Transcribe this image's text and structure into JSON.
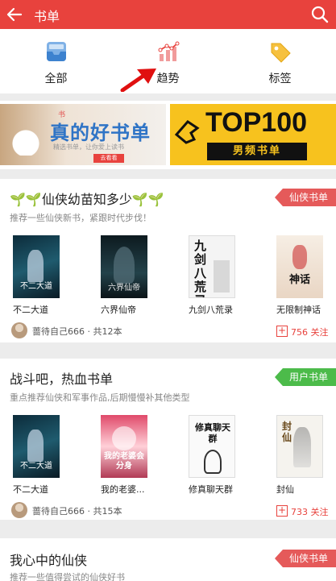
{
  "header": {
    "title": "书单"
  },
  "categories": [
    {
      "label": "全部",
      "icon": "inbox-icon"
    },
    {
      "label": "趋势",
      "icon": "trend-chart-icon"
    },
    {
      "label": "标签",
      "icon": "tag-icon"
    }
  ],
  "banners": [
    {
      "headline": "真的好书单",
      "top_text": "书",
      "sub_text": "精选书单，让你爱上读书",
      "button": "去看看"
    },
    {
      "headline": "TOP100",
      "sub_text": "男频书单"
    }
  ],
  "sections": [
    {
      "title": "仙侠幼苗知多少",
      "description": "推荐一些仙侠新书，紧跟时代步伐！",
      "tag": "仙侠书单",
      "books": [
        {
          "name": "不二大道",
          "cover_text": "不二大道"
        },
        {
          "name": "六界仙帝",
          "cover_text": "六界仙帝"
        },
        {
          "name": "九剑八荒录",
          "cover_text": "九剑八荒录"
        },
        {
          "name": "无限制神话",
          "cover_text": "神话"
        }
      ],
      "owner": "蔷待自己666 · 共12本",
      "follow": "756 关注"
    },
    {
      "title": "战斗吧，热血书单",
      "description": "重点推荐仙侠和军事作品,后期慢慢补其他类型",
      "tag": "用户书单",
      "books": [
        {
          "name": "不二大道",
          "cover_text": "不二大道"
        },
        {
          "name": "我的老婆...",
          "cover_text": "我的老婆会分身"
        },
        {
          "name": "修真聊天群",
          "cover_text": "修真聊天群"
        },
        {
          "name": "封仙",
          "cover_text": "封仙"
        }
      ],
      "owner": "蔷待自己666 · 共15本",
      "follow": "733 关注"
    },
    {
      "title": "我心中的仙侠",
      "description": "推荐一些值得尝试的仙侠好书",
      "tag": "仙侠书单"
    }
  ],
  "colors": {
    "brand": "#e8423d",
    "tag_red": "#e55a5a",
    "tag_green": "#4cbb4a",
    "banner_yellow": "#f7c21e"
  }
}
